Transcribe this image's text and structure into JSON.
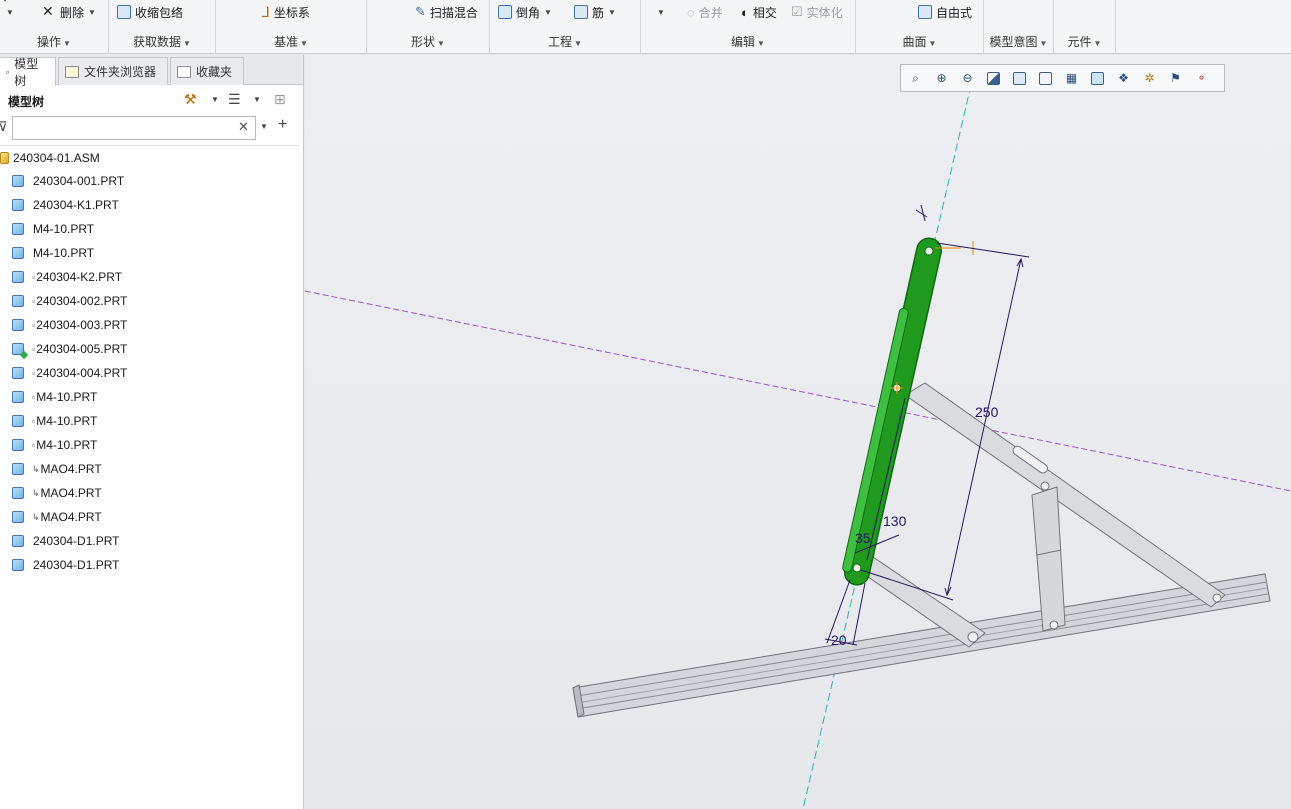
{
  "ribbon": {
    "groups": [
      {
        "label": "操作"
      },
      {
        "label": "获取数据"
      },
      {
        "label": "基准"
      },
      {
        "label": "形状"
      },
      {
        "label": "工程"
      },
      {
        "label": "编辑"
      },
      {
        "label": "曲面"
      },
      {
        "label": "模型意图"
      },
      {
        "label": "元件"
      }
    ],
    "items": {
      "delete": "删除",
      "shrinkwrap": "收缩包络",
      "csys": "坐标系",
      "sweep_blend": "扫描混合",
      "round": "倒角",
      "rib": "筋",
      "merge": "合并",
      "intersect": "相交",
      "solidify": "实体化",
      "freestyle": "自由式"
    }
  },
  "left_panel": {
    "tabs": [
      {
        "label": "模型树"
      },
      {
        "label": "文件夹浏览器"
      },
      {
        "label": "收藏夹"
      }
    ],
    "header_title": "模型树",
    "filter": {
      "value": "",
      "placeholder": ""
    },
    "root": "240304-01.ASM",
    "nodes": [
      {
        "name": "240304-001.PRT",
        "mark": ""
      },
      {
        "name": "240304-K1.PRT",
        "mark": ""
      },
      {
        "name": "M4-10.PRT",
        "mark": ""
      },
      {
        "name": "M4-10.PRT",
        "mark": ""
      },
      {
        "name": "240304-K2.PRT",
        "mark": "▫"
      },
      {
        "name": "240304-002.PRT",
        "mark": "▫"
      },
      {
        "name": "240304-003.PRT",
        "mark": "▫"
      },
      {
        "name": "240304-005.PRT",
        "mark": "▫"
      },
      {
        "name": "240304-004.PRT",
        "mark": "▫"
      },
      {
        "name": "M4-10.PRT",
        "mark": "▫"
      },
      {
        "name": "M4-10.PRT",
        "mark": "▫"
      },
      {
        "name": "M4-10.PRT",
        "mark": "▫"
      },
      {
        "name": "MAO4.PRT",
        "mark": "↳"
      },
      {
        "name": "MAO4.PRT",
        "mark": "↳"
      },
      {
        "name": "MAO4.PRT",
        "mark": "↳"
      },
      {
        "name": "240304-D1.PRT",
        "mark": ""
      },
      {
        "name": "240304-D1.PRT",
        "mark": ""
      }
    ]
  },
  "viewport": {
    "dimensions": {
      "d250": "250",
      "d130": "130",
      "d35": "35",
      "d20": "20"
    },
    "colors": {
      "selected": "#1f9a1f",
      "axis": "#2cb3b3",
      "plane": "#9a55d6",
      "dimension": "#2a1660",
      "part": "#c9ccd2"
    }
  }
}
